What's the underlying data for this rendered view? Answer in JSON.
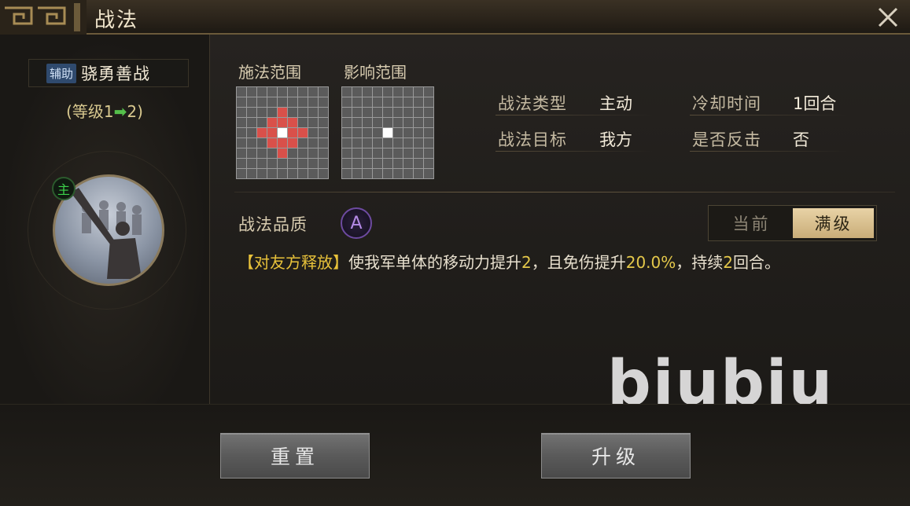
{
  "window": {
    "title": "战法"
  },
  "skill": {
    "tag": "辅助",
    "name": "骁勇善战",
    "level_prefix": "(等级1",
    "level_suffix": "2)",
    "badge": "主"
  },
  "ranges": {
    "cast_label": "施法范围",
    "effect_label": "影响范围"
  },
  "info": {
    "type_label": "战法类型",
    "type_value": "主动",
    "cooldown_label": "冷却时间",
    "cooldown_value": "1回合",
    "target_label": "战法目标",
    "target_value": "我方",
    "counter_label": "是否反击",
    "counter_value": "否"
  },
  "quality": {
    "label": "战法品质",
    "grade": "A"
  },
  "toggle": {
    "current": "当前",
    "max": "满级",
    "selected": "max"
  },
  "description": {
    "tag": "【对友方释放】",
    "part1": "使我军单体的移动力提升",
    "num1": "2",
    "part2": "，且免伤提升",
    "num2": "20.0%",
    "part3": "，持续",
    "num3": "2",
    "part4": "回合。"
  },
  "watermark": "biubiu",
  "buttons": {
    "reset": "重置",
    "upgrade": "升级"
  },
  "colors": {
    "accent_gold": "#e8c23a",
    "range_red": "#d9504a",
    "quality_purple": "#6d4aa0"
  }
}
